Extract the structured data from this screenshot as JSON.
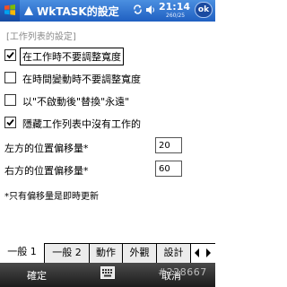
{
  "titlebar": {
    "title": "WkTASK的設定",
    "clock": "21:14",
    "clock_sub": "260/25",
    "ok_label": "ok",
    "start_icon": "windows-flag-icon",
    "sync_icon": "sync-icon",
    "volume_icon": "volume-icon"
  },
  "section": {
    "header": "[工作列表的設定]"
  },
  "options": [
    {
      "label": "在工作時不要調整寬度",
      "checked": true
    },
    {
      "label": "在時間變動時不要調整寬度",
      "checked": false
    },
    {
      "label": "以\"不啟動後\"替換\"永遠\"",
      "checked": false
    },
    {
      "label": "隱藏工作列表中沒有工作的",
      "checked": true
    }
  ],
  "fields": {
    "left_offset_label": "左方的位置偏移量*",
    "left_offset_value": "20",
    "right_offset_label": "右方的位置偏移量*",
    "right_offset_value": "60"
  },
  "note": "*只有偏移量是即時更新",
  "tabs": [
    "一般 1",
    "一般 2",
    "動作",
    "外觀",
    "設計"
  ],
  "softkeys": {
    "left": "確定",
    "right": "取消",
    "keyboard_icon": "keyboard-icon"
  },
  "watermark": "#228667",
  "colors": {
    "titlebar": "#2a6fd0",
    "softbar": "#2b2b2b",
    "section_header": "#8a8a8a"
  }
}
